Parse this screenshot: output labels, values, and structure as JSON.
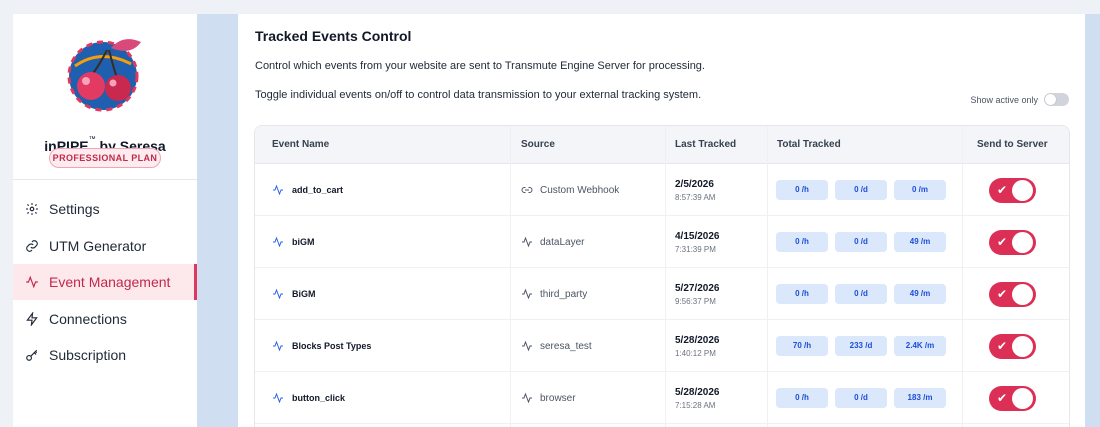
{
  "sidebar": {
    "brand": "inPIPE",
    "brand_tm": "™",
    "brand_suffix": " by Seresa",
    "plan_badge": "PROFESSIONAL PLAN",
    "items": [
      {
        "label": "Settings",
        "icon": "gear-icon"
      },
      {
        "label": "UTM Generator",
        "icon": "link-icon"
      },
      {
        "label": "Event Management",
        "icon": "activity-icon",
        "active": true
      },
      {
        "label": "Connections",
        "icon": "lightning-icon"
      },
      {
        "label": "Subscription",
        "icon": "key-icon"
      }
    ]
  },
  "main": {
    "title": "Tracked Events Control",
    "description_1": "Control which events from your website are sent to Transmute Engine Server for processing.",
    "description_2": "Toggle individual events on/off to control data transmission to your external tracking system.",
    "show_active_label": "Show active only",
    "columns": [
      "Event Name",
      "Source",
      "Last Tracked",
      "Total Tracked",
      "Send to Server"
    ],
    "rows": [
      {
        "name": "add_to_cart",
        "source": "Custom Webhook",
        "source_icon": "link-icon",
        "date": "2/5/2026",
        "time": "8:57:39 AM",
        "per_hour": "0 /h",
        "per_day": "0 /d",
        "per_month": "0 /m",
        "enabled": true
      },
      {
        "name": "biGM",
        "source": "dataLayer",
        "source_icon": "activity-icon",
        "date": "4/15/2026",
        "time": "7:31:39 PM",
        "per_hour": "0 /h",
        "per_day": "0 /d",
        "per_month": "49 /m",
        "enabled": true
      },
      {
        "name": "BiGM",
        "source": "third_party",
        "source_icon": "activity-icon",
        "date": "5/27/2026",
        "time": "9:56:37 PM",
        "per_hour": "0 /h",
        "per_day": "0 /d",
        "per_month": "49 /m",
        "enabled": true
      },
      {
        "name": "Blocks Post Types",
        "source": "seresa_test",
        "source_icon": "activity-icon",
        "date": "5/28/2026",
        "time": "1:40:12 PM",
        "per_hour": "70 /h",
        "per_day": "233 /d",
        "per_month": "2.4K /m",
        "enabled": true
      },
      {
        "name": "button_click",
        "source": "browser",
        "source_icon": "activity-icon",
        "date": "5/28/2026",
        "time": "7:15:28 AM",
        "per_hour": "0 /h",
        "per_day": "0 /d",
        "per_month": "183 /m",
        "enabled": true
      }
    ],
    "toggle_check": "✔"
  },
  "colors": {
    "accent": "#dc2f55",
    "band": "#cfdff1",
    "stat_pill": "#dbe7fb",
    "stat_text": "#1d4ed8"
  }
}
